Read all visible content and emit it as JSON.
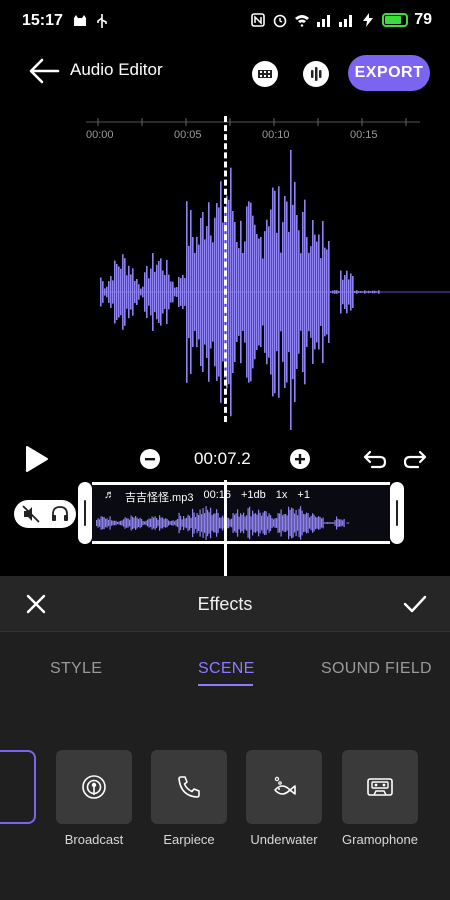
{
  "status_bar": {
    "time": "15:17",
    "battery_percent": "79",
    "battery_level": 0.79,
    "battery_color": "#3ddc3d"
  },
  "app_bar": {
    "title": "Audio Editor",
    "export_label": "EXPORT",
    "accent_color": "#7a64f0"
  },
  "ruler": {
    "ticks": [
      "00:00",
      "00:05",
      "00:10",
      "00:15"
    ]
  },
  "waveform": {
    "color": "#8f83f2"
  },
  "controls": {
    "current_time": "00:07.2"
  },
  "clip": {
    "file_name": "吉吉怪怪.mp3",
    "duration": "00:16",
    "gain": "+1db",
    "speed": "1x",
    "extra": "+1"
  },
  "effects": {
    "title": "Effects",
    "tabs": [
      {
        "label": "STYLE",
        "active": false
      },
      {
        "label": "SCENE",
        "active": true
      },
      {
        "label": "SOUND FIELD",
        "active": false
      }
    ],
    "items": [
      {
        "label": "Broadcast",
        "icon": "broadcast-icon"
      },
      {
        "label": "Earpiece",
        "icon": "phone-icon"
      },
      {
        "label": "Underwater",
        "icon": "fish-icon"
      },
      {
        "label": "Gramophone",
        "icon": "cassette-icon"
      }
    ],
    "active_color": "#8d7bff"
  }
}
